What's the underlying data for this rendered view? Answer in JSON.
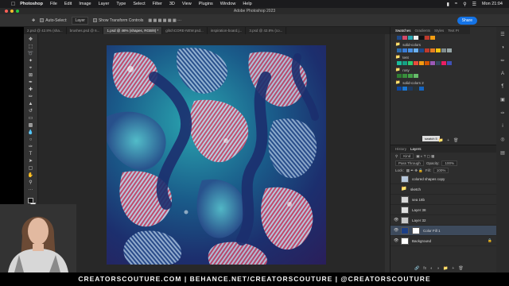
{
  "mac_menu": {
    "app": "Photoshop",
    "items": [
      "File",
      "Edit",
      "Image",
      "Layer",
      "Type",
      "Select",
      "Filter",
      "3D",
      "View",
      "Plugins",
      "Window",
      "Help"
    ],
    "clock": "Mon 21:04"
  },
  "window_title": "Adobe Photoshop 2023",
  "options_bar": {
    "auto_select_label": "Auto-Select:",
    "auto_select_value": "Layer",
    "transform_label": "Show Transform Controls",
    "share_label": "Share"
  },
  "tabs": [
    {
      "label": "2.psd @ 42.8% (sha..."
    },
    {
      "label": "brushes.psd @ 6..."
    },
    {
      "label": "1.psd @ 46% (shapes, RGB/8) *",
      "active": true
    },
    {
      "label": "glitchCORE-NEW.psd..."
    },
    {
      "label": "inspiration-board.j..."
    },
    {
      "label": "3.psd @ 42.8% (co..."
    }
  ],
  "swatches_panel": {
    "tabs": [
      "Swatches",
      "Gradients",
      "Styles",
      "Text Pr"
    ],
    "groups": [
      {
        "name": "solid-colors",
        "colors": [
          "#2b6cb0",
          "#3a7bd5",
          "#4a90e2",
          "#6bb0f0",
          "#1e4a8a",
          "#c0392b",
          "#e67e22",
          "#f1c40f",
          "#7f8c8d",
          "#95a5a6",
          "#bdc3c7",
          "#ecf0f1",
          "#8e44ad",
          "#d35400"
        ]
      },
      {
        "name": "tent",
        "colors": [
          "#1abc9c",
          "#16a085",
          "#2ecc71",
          "#e74c3c",
          "#c0392b",
          "#f39c12",
          "#d35400",
          "#9b59b6",
          "#8e44ad",
          "#34495e",
          "#e91e63",
          "#ff5722",
          "#009688",
          "#3f51b5"
        ]
      },
      {
        "name": "rosy",
        "colors": [
          "#2e7d32",
          "#388e3c",
          "#43a047",
          "#66bb6a"
        ]
      },
      {
        "name": "solid-colors 2",
        "colors": [
          "#0d47a1",
          "#1976d2",
          "#1e3a5f",
          "#263238",
          "#1565c0"
        ]
      }
    ],
    "tooltip": "swatch 5"
  },
  "layers_panel": {
    "tabs": [
      "History",
      "Layers"
    ],
    "kind_label": "Kind",
    "blend_mode": "Pass Through",
    "opacity_label": "Opacity:",
    "opacity_value": "100%",
    "lock_label": "Lock:",
    "fill_label": "Fill:",
    "fill_value": "100%",
    "layers": [
      {
        "name": "colored shapes copy",
        "visible": false,
        "type": "folder"
      },
      {
        "name": "sketch",
        "visible": false,
        "type": "folder"
      },
      {
        "name": "sea 18b",
        "visible": false,
        "type": "image"
      },
      {
        "name": "Layer 38",
        "visible": false,
        "type": "image"
      },
      {
        "name": "Layer 32",
        "visible": true,
        "type": "image"
      },
      {
        "name": "Color Fill 1",
        "visible": true,
        "type": "fill",
        "selected": true
      },
      {
        "name": "Background",
        "visible": true,
        "type": "background"
      }
    ]
  },
  "banner": "CREATORSCOUTURE.COM  |  BEHANCE.NET/CREATORSCOUTURE  |  @CREATORSCOUTURE",
  "colors": {
    "ps_panel": "#2d2d2d",
    "canvas_bg": "#282828",
    "accent": "#1473e6",
    "art_blue": "#1c2f6e",
    "art_teal": "#2aa6b0",
    "art_pink": "#d24a6a"
  }
}
